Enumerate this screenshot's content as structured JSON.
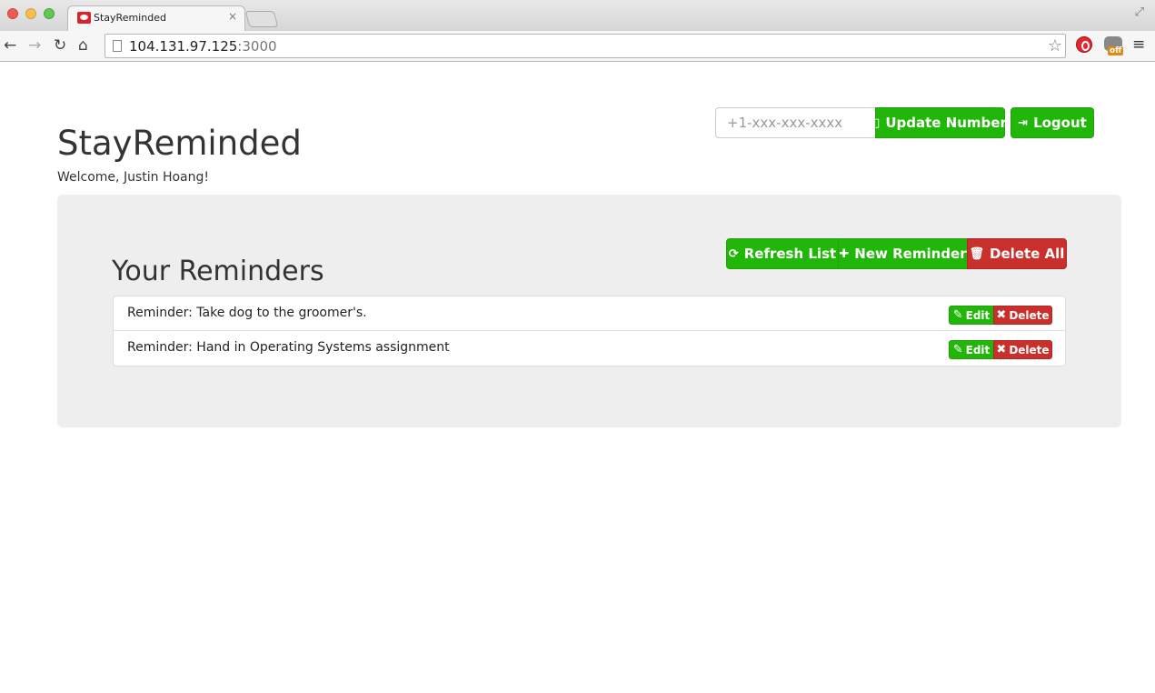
{
  "browser": {
    "tab_title": "StayReminded",
    "tab_close": "×",
    "url_host": "104.131.97.125",
    "url_port": ":3000",
    "ext_badge": "off"
  },
  "header": {
    "phone_placeholder": "+1-xxx-xxx-xxxx",
    "update_label": "Update Number",
    "logout_label": "Logout",
    "app_title": "StayReminded",
    "welcome": "Welcome, Justin Hoang!"
  },
  "reminders": {
    "title": "Your Reminders",
    "refresh_label": "Refresh List",
    "new_label": "New Reminder",
    "delete_all_label": "Delete All",
    "edit_label": "Edit",
    "delete_label": "Delete",
    "items": [
      {
        "text": "Reminder: Take dog to the groomer's."
      },
      {
        "text": "Reminder: Hand in Operating Systems assignment"
      }
    ]
  },
  "colors": {
    "success": "#22b60a",
    "danger": "#c9302c",
    "panel": "#eeeeee"
  }
}
